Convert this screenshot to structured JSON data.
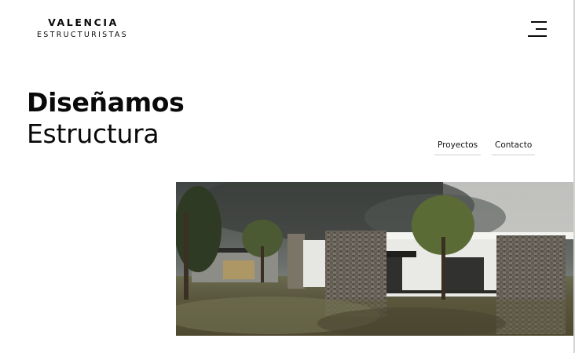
{
  "brand": {
    "line1": "VALENCIA",
    "line2": "ESTRUCTURISTAS"
  },
  "header": {
    "menu_icon": "hamburger-menu-icon"
  },
  "hero": {
    "title_bold": "Diseñamos",
    "title_regular": "Estructura"
  },
  "nav": {
    "links": [
      {
        "label": "Proyectos"
      },
      {
        "label": "Contacto"
      }
    ]
  },
  "colors": {
    "text": "#0a0a0a",
    "background": "#ffffff",
    "link_underline": "#cfcfcf"
  }
}
